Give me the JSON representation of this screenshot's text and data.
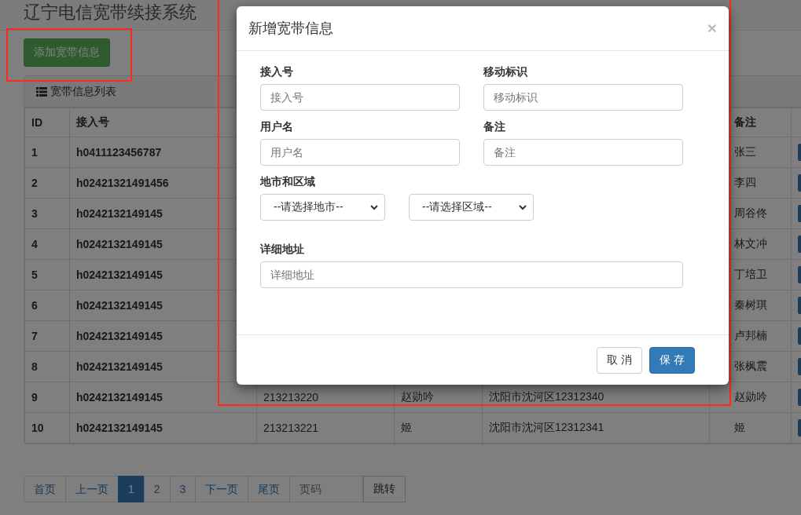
{
  "header": {
    "title": "辽宁电信宽带续接系统"
  },
  "add_button": "添加宽带信息",
  "panel": {
    "title": "宽带信息列表",
    "columns": [
      "ID",
      "接入号",
      "备注"
    ],
    "rows": [
      {
        "id": "1",
        "access_no": "h0411123456787",
        "note": "张三"
      },
      {
        "id": "2",
        "access_no": "h02421321491456",
        "note": "李四"
      },
      {
        "id": "3",
        "access_no": "h0242132149145",
        "note": "周谷佟"
      },
      {
        "id": "4",
        "access_no": "h0242132149145",
        "note": "林文冲"
      },
      {
        "id": "5",
        "access_no": "h0242132149145",
        "note": "丁培卫"
      },
      {
        "id": "6",
        "access_no": "h0242132149145",
        "note": "秦树琪"
      },
      {
        "id": "7",
        "access_no": "h0242132149145",
        "note": "卢邦楠"
      },
      {
        "id": "8",
        "access_no": "h0242132149145",
        "note": "张枫震"
      },
      {
        "id": "9",
        "access_no": "h0242132149145",
        "column_3": "213213220",
        "column_4": "赵勋吟",
        "column_5": "沈阳市沈河区12312340",
        "note": "赵勋吟"
      },
      {
        "id": "10",
        "access_no": "h0242132149145",
        "column_3": "213213221",
        "column_4": "姬",
        "column_5": "沈阳市沈河区12312341",
        "note": "姬"
      }
    ]
  },
  "pagination": {
    "pages": [
      {
        "label": "首页",
        "selected": false
      },
      {
        "label": "上一页",
        "selected": false
      },
      {
        "label": "1",
        "selected": true
      },
      {
        "label": "2",
        "selected": false
      },
      {
        "label": "3",
        "selected": false
      },
      {
        "label": "下一页",
        "selected": false
      },
      {
        "label": "尾页",
        "selected": false
      }
    ],
    "page_input": {
      "placeholder": "页码"
    },
    "go_button": "跳转"
  },
  "modal": {
    "title": "新增宽带信息",
    "close": "×",
    "fields": [
      {
        "label": "接入号",
        "placeholder": "接入号"
      },
      {
        "label": "移动标识",
        "placeholder": "移动标识"
      },
      {
        "label": "用户名",
        "placeholder": "用户名"
      },
      {
        "label": "备注",
        "placeholder": "备注"
      }
    ],
    "region": {
      "label": "地市和区域",
      "selects": [
        "--请选择地市--",
        "--请选择区域--"
      ]
    },
    "address": {
      "label": "详细地址",
      "placeholder": "详细地址"
    },
    "cancel": "取 消",
    "save": "保 存"
  }
}
